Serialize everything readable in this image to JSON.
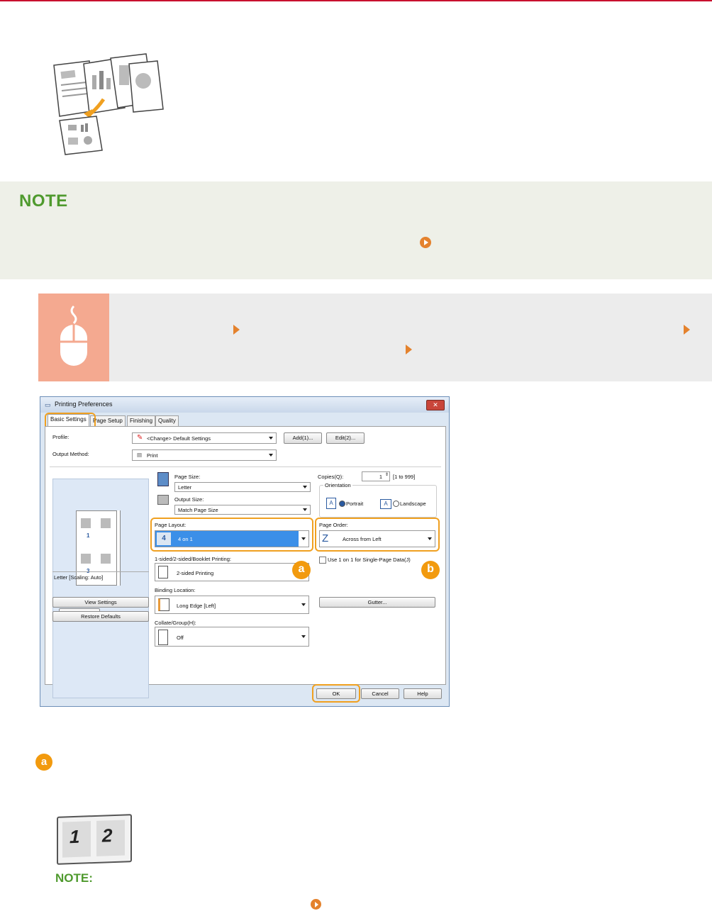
{
  "dialog": {
    "title": "Printing Preferences",
    "close_label": "✕",
    "tabs": [
      "Basic Settings",
      "Page Setup",
      "Finishing",
      "Quality"
    ],
    "profile_label": "Profile:",
    "profile_value": "<Change> Default Settings",
    "add_button": "Add(1)...",
    "edit_button": "Edit(2)...",
    "output_method_label": "Output Method:",
    "output_method_value": "Print",
    "page_size_label": "Page Size:",
    "page_size_value": "Letter",
    "output_size_label": "Output Size:",
    "output_size_value": "Match Page Size",
    "copies_label": "Copies(Q):",
    "copies_value": "1",
    "copies_range": "[1 to 999]",
    "orientation_label": "Orientation",
    "portrait_label": "Portrait",
    "landscape_label": "Landscape",
    "page_layout_label": "Page Layout:",
    "page_layout_value": "4 on 1",
    "page_layout_icon_num": "4",
    "page_order_label": "Page Order:",
    "page_order_value": "Across from Left",
    "sided_label": "1-sided/2-sided/Booklet Printing:",
    "sided_value": "2-sided Printing",
    "use_1on1_label": "Use 1 on 1 for Single-Page Data(J)",
    "binding_label": "Binding Location:",
    "binding_value": "Long Edge [Left]",
    "gutter_button": "Gutter...",
    "collate_label": "Collate/Group(H):",
    "collate_value": "Off",
    "preview_status": "Letter [Scaling: Auto]",
    "preview_page_1": "1",
    "preview_page_3": "3",
    "view_settings_button": "View Settings",
    "restore_defaults_button": "Restore Defaults",
    "ok_button": "OK",
    "cancel_button": "Cancel",
    "help_button": "Help",
    "badge_a": "a",
    "badge_b": "b"
  },
  "note_title": "NOTE",
  "section_badge": "a",
  "page_icon_1": "1",
  "page_icon_2": "2",
  "note2_title": "NOTE:"
}
